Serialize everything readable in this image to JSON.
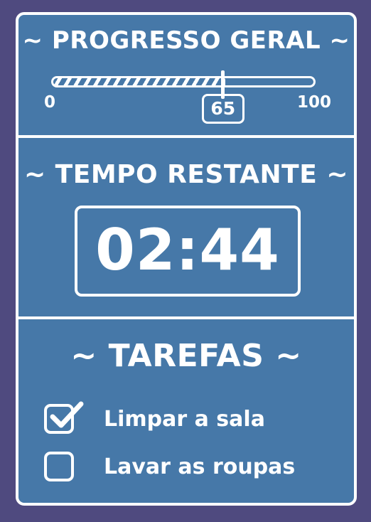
{
  "progress": {
    "title": "~ PROGRESSO GERAL ~",
    "min": "0",
    "max": "100",
    "value": "65",
    "fraction": 0.65
  },
  "timer": {
    "title": "~ TEMPO RESTANTE ~",
    "value": "02:44"
  },
  "tasks": {
    "title": "~ TAREFAS ~",
    "items": [
      {
        "label": "Limpar a sala",
        "checked": true,
        "icon": "checkmark-icon"
      },
      {
        "label": "Lavar as roupas",
        "checked": false,
        "icon": "empty-checkbox-icon"
      }
    ]
  },
  "colors": {
    "background": "#4f4a7f",
    "panel": "#4678a8",
    "foreground": "#ffffff"
  }
}
